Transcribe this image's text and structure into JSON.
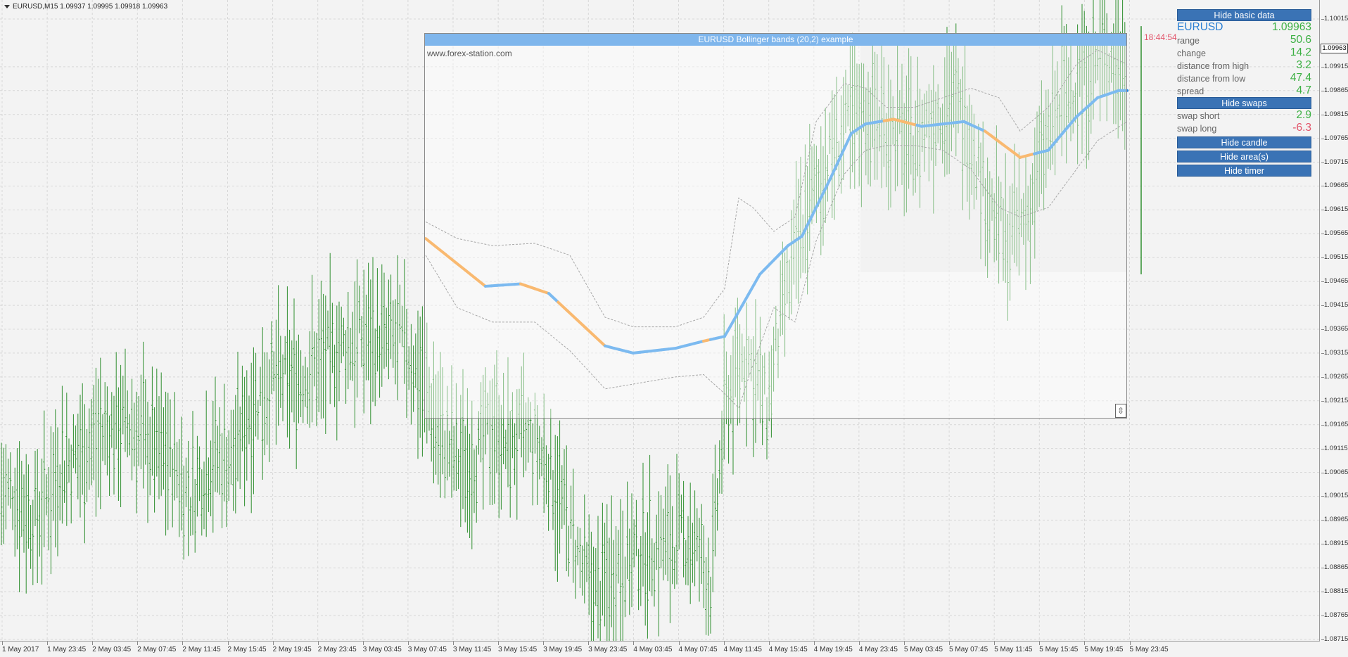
{
  "header": {
    "symbol_info": "EURUSD,M15  1.09937 1.09995 1.09918 1.09963"
  },
  "price_axis": {
    "ticks": [
      "1.10015",
      "1.09915",
      "1.09865",
      "1.09815",
      "1.09765",
      "1.09715",
      "1.09665",
      "1.09615",
      "1.09565",
      "1.09515",
      "1.09465",
      "1.09415",
      "1.09365",
      "1.09315",
      "1.09265",
      "1.09215",
      "1.09165",
      "1.09115",
      "1.09065",
      "1.09015",
      "1.08965",
      "1.08915",
      "1.08865",
      "1.08815",
      "1.08765",
      "1.08715"
    ],
    "current_price": "1.09963"
  },
  "time_axis": {
    "ticks": [
      "1 May 2017",
      "1 May 23:45",
      "2 May 03:45",
      "2 May 07:45",
      "2 May 11:45",
      "2 May 15:45",
      "2 May 19:45",
      "2 May 23:45",
      "3 May 03:45",
      "3 May 07:45",
      "3 May 11:45",
      "3 May 15:45",
      "3 May 19:45",
      "3 May 23:45",
      "4 May 03:45",
      "4 May 07:45",
      "4 May 11:45",
      "4 May 15:45",
      "4 May 19:45",
      "4 May 23:45",
      "5 May 03:45",
      "5 May 07:45",
      "5 May 11:45",
      "5 May 15:45",
      "5 May 19:45",
      "5 May 23:45"
    ]
  },
  "object_box": {
    "title": "EURUSD Bollinger bands (20,2) example",
    "url": "www.forex-station.com",
    "resize_glyph": "⇳"
  },
  "countdown": "18:44:54",
  "panel": {
    "hide_basic_label": "Hide basic data",
    "symbol": "EURUSD",
    "price": "1.09963",
    "rows": [
      {
        "label": "range",
        "value": "50.6"
      },
      {
        "label": "change",
        "value": "14.2"
      },
      {
        "label": "distance from high",
        "value": "3.2"
      },
      {
        "label": "distance from low",
        "value": "47.4"
      },
      {
        "label": "spread",
        "value": "4.7"
      }
    ],
    "hide_swaps_label": "Hide swaps",
    "swaps": [
      {
        "label": "swap short",
        "value": "2.9"
      },
      {
        "label": "swap long",
        "value": "-6.3"
      }
    ],
    "hide_candle_label": "Hide candle",
    "hide_areas_label": "Hide area(s)",
    "hide_timer_label": "Hide timer"
  },
  "colors": {
    "bars": "#2f8f2f",
    "ma_up": "#1e88e5",
    "ma_down": "#f5870a",
    "bands": "#6a6a6a",
    "button": "#3a73b5",
    "positive": "#3cb043",
    "negative": "#e2546a",
    "symbol": "#2a7fd4"
  },
  "chart_data": {
    "type": "line",
    "instrument": "EURUSD",
    "timeframe": "M15",
    "x_labels": [
      "1 May 2017",
      "1 May 23:45",
      "2 May 03:45",
      "2 May 07:45",
      "2 May 11:45",
      "2 May 15:45",
      "2 May 19:45",
      "2 May 23:45",
      "3 May 03:45",
      "3 May 07:45",
      "3 May 11:45",
      "3 May 15:45",
      "3 May 19:45",
      "3 May 23:45",
      "4 May 03:45",
      "4 May 07:45",
      "4 May 11:45",
      "4 May 15:45",
      "4 May 19:45",
      "4 May 23:45",
      "5 May 03:45",
      "5 May 07:45",
      "5 May 11:45",
      "5 May 15:45",
      "5 May 19:45",
      "5 May 23:45"
    ],
    "ylim": [
      1.08715,
      1.10015
    ],
    "price_path": [
      [
        0,
        1.0902
      ],
      [
        20,
        1.0903
      ],
      [
        45,
        1.0897
      ],
      [
        60,
        1.0899
      ],
      [
        85,
        1.0908
      ],
      [
        110,
        1.091
      ],
      [
        150,
        1.0915
      ],
      [
        180,
        1.0917
      ],
      [
        210,
        1.0913
      ],
      [
        250,
        1.0908
      ],
      [
        270,
        1.0901
      ],
      [
        300,
        1.091
      ],
      [
        330,
        1.0909
      ],
      [
        350,
        1.0918
      ],
      [
        380,
        1.0925
      ],
      [
        420,
        1.0926
      ],
      [
        460,
        1.093
      ],
      [
        510,
        1.0935
      ],
      [
        540,
        1.0934
      ],
      [
        570,
        1.0934
      ],
      [
        600,
        1.0926
      ],
      [
        630,
        1.0913
      ],
      [
        650,
        1.0909
      ],
      [
        680,
        1.091
      ],
      [
        700,
        1.0917
      ],
      [
        720,
        1.0912
      ],
      [
        750,
        1.0914
      ],
      [
        780,
        1.0908
      ],
      [
        800,
        1.0899
      ],
      [
        830,
        1.0885
      ],
      [
        850,
        1.0881
      ],
      [
        880,
        1.0888
      ],
      [
        920,
        1.089
      ],
      [
        950,
        1.0892
      ],
      [
        980,
        1.0893
      ],
      [
        1000,
        1.0887
      ],
      [
        1010,
        1.0883
      ],
      [
        1030,
        1.092
      ],
      [
        1060,
        1.0932
      ],
      [
        1090,
        1.092
      ],
      [
        1110,
        1.0938
      ],
      [
        1140,
        1.0958
      ],
      [
        1170,
        1.097
      ],
      [
        1200,
        1.0978
      ],
      [
        1230,
        1.0982
      ],
      [
        1260,
        1.098
      ],
      [
        1290,
        1.0975
      ],
      [
        1320,
        1.098
      ],
      [
        1350,
        1.0985
      ],
      [
        1380,
        1.0978
      ],
      [
        1400,
        1.0965
      ],
      [
        1430,
        1.0955
      ],
      [
        1460,
        1.096
      ],
      [
        1480,
        1.0972
      ],
      [
        1510,
        1.0985
      ],
      [
        1540,
        1.099
      ],
      [
        1570,
        1.0995
      ],
      [
        1600,
        1.0991
      ],
      [
        1620,
        1.099
      ]
    ],
    "series": [
      {
        "name": "",
        "role": "moving average",
        "values": [
          [
            605,
            1.09555
          ],
          [
            690,
            1.09455
          ],
          [
            740,
            1.0946
          ],
          [
            780,
            1.0944
          ],
          [
            860,
            1.0933
          ],
          [
            900,
            1.09315
          ],
          [
            960,
            1.09325
          ],
          [
            1000,
            1.0934
          ],
          [
            1030,
            1.0935
          ],
          [
            1080,
            1.0948
          ],
          [
            1120,
            1.0954
          ],
          [
            1140,
            1.0956
          ],
          [
            1180,
            1.0968
          ],
          [
            1210,
            1.09775
          ],
          [
            1230,
            1.09795
          ],
          [
            1270,
            1.09805
          ],
          [
            1310,
            1.0979
          ],
          [
            1370,
            1.098
          ],
          [
            1400,
            1.0978
          ],
          [
            1450,
            1.09725
          ],
          [
            1490,
            1.0974
          ],
          [
            1530,
            1.0981
          ],
          [
            1560,
            1.0985
          ],
          [
            1590,
            1.09865
          ],
          [
            1602,
            1.09865
          ]
        ]
      },
      {
        "name": "",
        "role": "upper band",
        "values": [
          [
            605,
            1.0959
          ],
          [
            650,
            1.09555
          ],
          [
            700,
            1.0954
          ],
          [
            760,
            1.09545
          ],
          [
            810,
            1.0952
          ],
          [
            860,
            1.0939
          ],
          [
            900,
            1.0937
          ],
          [
            960,
            1.0937
          ],
          [
            1000,
            1.0939
          ],
          [
            1030,
            1.0945
          ],
          [
            1050,
            1.0964
          ],
          [
            1070,
            1.0962
          ],
          [
            1100,
            1.0957
          ],
          [
            1130,
            1.096
          ],
          [
            1160,
            1.098
          ],
          [
            1200,
            1.0988
          ],
          [
            1230,
            1.0987
          ],
          [
            1260,
            1.0983
          ],
          [
            1300,
            1.0983
          ],
          [
            1340,
            1.0985
          ],
          [
            1380,
            1.0987
          ],
          [
            1420,
            1.0985
          ],
          [
            1450,
            1.0978
          ],
          [
            1490,
            1.0983
          ],
          [
            1530,
            1.0992
          ],
          [
            1560,
            1.0995
          ],
          [
            1602,
            1.0992
          ]
        ]
      },
      {
        "name": "",
        "role": "lower band",
        "values": [
          [
            605,
            1.0952
          ],
          [
            650,
            1.0941
          ],
          [
            700,
            1.0938
          ],
          [
            760,
            1.0938
          ],
          [
            810,
            1.0932
          ],
          [
            860,
            1.0924
          ],
          [
            900,
            1.0925
          ],
          [
            960,
            1.09265
          ],
          [
            1000,
            1.0927
          ],
          [
            1030,
            1.0923
          ],
          [
            1050,
            1.092
          ],
          [
            1070,
            1.0929
          ],
          [
            1100,
            1.0941
          ],
          [
            1130,
            1.0938
          ],
          [
            1160,
            1.0955
          ],
          [
            1200,
            1.0969
          ],
          [
            1230,
            1.0974
          ],
          [
            1260,
            1.0975
          ],
          [
            1300,
            1.0975
          ],
          [
            1340,
            1.0974
          ],
          [
            1380,
            1.097
          ],
          [
            1420,
            1.0962
          ],
          [
            1450,
            1.096
          ],
          [
            1490,
            1.0962
          ],
          [
            1530,
            1.097
          ],
          [
            1560,
            1.0976
          ],
          [
            1602,
            1.098
          ]
        ]
      }
    ],
    "ma_down_segments": [
      [
        605,
        690
      ],
      [
        740,
        780
      ],
      [
        800,
        860
      ],
      [
        1000,
        1010
      ],
      [
        1260,
        1300
      ],
      [
        1400,
        1470
      ]
    ]
  }
}
